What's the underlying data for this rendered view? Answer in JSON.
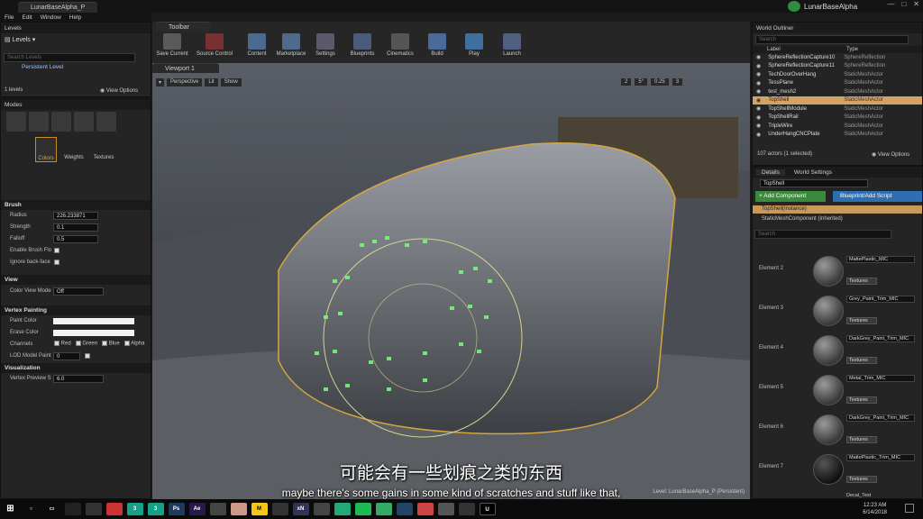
{
  "window": {
    "tab_title": "LunarBaseAlpha_P",
    "app_title": "LunarBaseAlpha"
  },
  "menu": [
    "File",
    "Edit",
    "Window",
    "Help"
  ],
  "levels": {
    "tab": "Levels",
    "dropdown": "Levels",
    "search_placeholder": "Search Levels",
    "persistent_level": "Persistent Level",
    "count": "1 levels",
    "view_options": "View Options"
  },
  "modes": {
    "tab": "Modes",
    "tools": [
      "Colors",
      "Weights",
      "Textures"
    ],
    "brush_section": "Brush",
    "radius_label": "Radius",
    "radius_value": "226.233871",
    "strength_label": "Strength",
    "strength_value": "0.1",
    "falloff_label": "Falloff",
    "falloff_value": "0.5",
    "enable_brush_label": "Enable Brush Flo",
    "ignore_backface_label": "Ignore back-face",
    "view_section": "View",
    "color_view_mode_label": "Color View Mode",
    "color_view_mode_value": "Off",
    "vertex_section": "Vertex Painting",
    "paint_color_label": "Paint Color",
    "erase_color_label": "Erase Color",
    "channels_label": "Channels",
    "channels": [
      "Red",
      "Green",
      "Blue",
      "Alpha"
    ],
    "lod_label": "LOD Model Paint",
    "lod_value": "0",
    "vis_section": "Visualization",
    "vertex_preview_label": "Vertex Preview S",
    "vertex_preview_value": "6.0"
  },
  "toolbar": {
    "tab": "Toolbar",
    "buttons": [
      "Save Current",
      "Source Control",
      "Content",
      "Marketplace",
      "Settings",
      "Blueprints",
      "Cinematics",
      "Build",
      "Play",
      "Launch"
    ]
  },
  "viewport": {
    "tab": "Viewport 1",
    "perspective": "Perspective",
    "lit": "Lit",
    "show": "Show",
    "snap_values": [
      "2",
      "5°",
      "0.25",
      "3"
    ],
    "level_label": "Level:",
    "level_name": "LunarBaseAlpha_P (Persistent)"
  },
  "outliner": {
    "tab": "World Outliner",
    "search_placeholder": "Search",
    "col_label": "Label",
    "col_type": "Type",
    "rows": [
      {
        "label": "SphereReflectionCapture10",
        "type": "SphereReflection"
      },
      {
        "label": "SphereReflectionCapture11",
        "type": "SphereReflection"
      },
      {
        "label": "TechDoorOverHang",
        "type": "StaticMeshActor"
      },
      {
        "label": "TessPlane",
        "type": "StaticMeshActor"
      },
      {
        "label": "test_mesh2",
        "type": "StaticMeshActor"
      },
      {
        "label": "TopShell",
        "type": "StaticMeshActor"
      },
      {
        "label": "TopShellModule",
        "type": "StaticMeshActor"
      },
      {
        "label": "TopShellRail",
        "type": "StaticMeshActor"
      },
      {
        "label": "TripleWire",
        "type": "StaticMeshActor"
      },
      {
        "label": "UnderHangCNCPlate",
        "type": "StaticMeshActor"
      }
    ],
    "count": "107 actors (1 selected)",
    "view_options": "View Options"
  },
  "details": {
    "tab": "Details",
    "tab2": "World Settings",
    "name_value": "TopShell",
    "add_component": "+ Add Component",
    "blueprint_script": "Blueprint/Add Script",
    "instance_label": "TopShell(Instance)",
    "component_label": "StaticMeshComponent (Inherited)",
    "search_placeholder": "Search",
    "elements": [
      {
        "label": "Element 2",
        "material": "MattePlastic_MIC"
      },
      {
        "label": "Element 3",
        "material": "Grey_Paint_Trim_MIC"
      },
      {
        "label": "Element 4",
        "material": "DarkGrey_Paint_Trim_MIC"
      },
      {
        "label": "Element 5",
        "material": "Metal_Trim_MIC"
      },
      {
        "label": "Element 6",
        "material": "DarkGrey_Paint_Trim_MIC"
      },
      {
        "label": "Element 7",
        "material": "MattePlastic_Trim_MIC"
      }
    ],
    "textures_label": "Textures",
    "partial_next": "Decal_Test"
  },
  "subtitle": {
    "cn": "可能会有一些划痕之类的东西",
    "en": "maybe there's some gains in some kind of scratches and stuff like that,"
  },
  "taskbar": {
    "time": "12:23 AM",
    "date": "6/14/2018"
  }
}
